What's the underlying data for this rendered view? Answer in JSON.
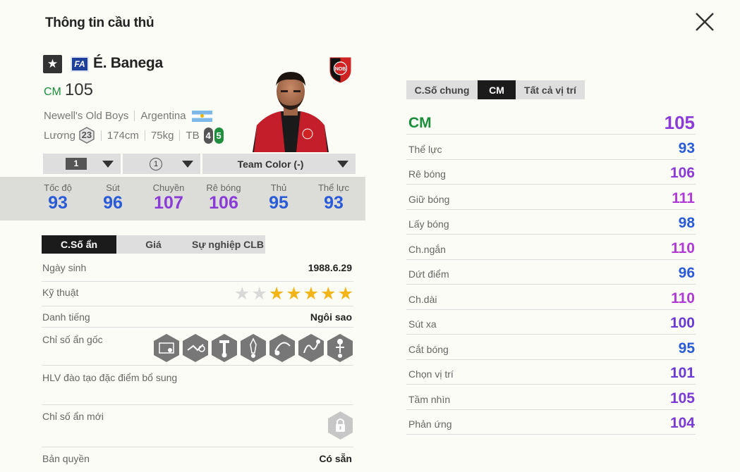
{
  "header": {
    "title": "Thông tin cầu thủ"
  },
  "player": {
    "badge_fa": "FA",
    "name": "É. Banega",
    "position": "CM",
    "overall": "105",
    "club": "Newell's Old Boys",
    "nation": "Argentina",
    "salary_label": "Lương",
    "salary": "23",
    "height": "174cm",
    "weight": "75kg",
    "body_type": "TB",
    "weak_foot": "4",
    "strong_foot": "5",
    "club_logo_text": "NOB"
  },
  "dropdowns": {
    "upgrade_level": "1",
    "training_level": "1",
    "team_color": "Team Color (-)"
  },
  "main_stats": [
    {
      "label": "Tốc độ",
      "value": "93",
      "color": "#2a5bd7"
    },
    {
      "label": "Sút",
      "value": "96",
      "color": "#2a5bd7"
    },
    {
      "label": "Chuyền",
      "value": "107",
      "color": "#8a3ad6"
    },
    {
      "label": "Rê bóng",
      "value": "106",
      "color": "#8a3ad6"
    },
    {
      "label": "Thủ",
      "value": "95",
      "color": "#2a5bd7"
    },
    {
      "label": "Thể lực",
      "value": "93",
      "color": "#2a5bd7"
    }
  ],
  "left_tabs": [
    "C.Số ẩn",
    "Giá",
    "Sự nghiệp CLB"
  ],
  "hidden": {
    "birth_label": "Ngày sinh",
    "birth_value": "1988.6.29",
    "skill_label": "Kỹ thuật",
    "skill_stars": 5,
    "reputation_label": "Danh tiếng",
    "reputation_value": "Ngôi sao",
    "traits_label": "Chỉ số ẩn gốc",
    "traits": [
      "long-shot-taker-icon",
      "flair-icon",
      "playmaker-icon",
      "early-crosser-icon",
      "outside-foot-icon",
      "speed-dribbler-icon",
      "power-header-icon"
    ],
    "coach_label": "HLV đào tạo đặc điểm bổ sung",
    "new_traits_label": "Chỉ số ẩn mới",
    "copyright_label": "Bản quyền",
    "copyright_value": "Có sẵn"
  },
  "right_tabs": [
    "C.Số chung",
    "CM",
    "Tất cả vị trí"
  ],
  "detailed": {
    "position": "CM",
    "position_value": "105",
    "rows": [
      {
        "label": "Thể lực",
        "value": "93",
        "color": "#2a5bd7"
      },
      {
        "label": "Rê bóng",
        "value": "106",
        "color": "#8a3ad6"
      },
      {
        "label": "Giữ bóng",
        "value": "111",
        "color": "#b03ad6"
      },
      {
        "label": "Lấy bóng",
        "value": "98",
        "color": "#2a5bd7"
      },
      {
        "label": "Ch.ngắn",
        "value": "110",
        "color": "#b03ad6"
      },
      {
        "label": "Dứt điểm",
        "value": "96",
        "color": "#2a5bd7"
      },
      {
        "label": "Ch.dài",
        "value": "110",
        "color": "#b03ad6"
      },
      {
        "label": "Sút xa",
        "value": "100",
        "color": "#6a3ad6"
      },
      {
        "label": "Cắt bóng",
        "value": "95",
        "color": "#2a5bd7"
      },
      {
        "label": "Chọn vị trí",
        "value": "101",
        "color": "#6a3ad6"
      },
      {
        "label": "Tầm nhìn",
        "value": "105",
        "color": "#7a3ad6"
      },
      {
        "label": "Phản ứng",
        "value": "104",
        "color": "#7a3ad6"
      }
    ]
  }
}
